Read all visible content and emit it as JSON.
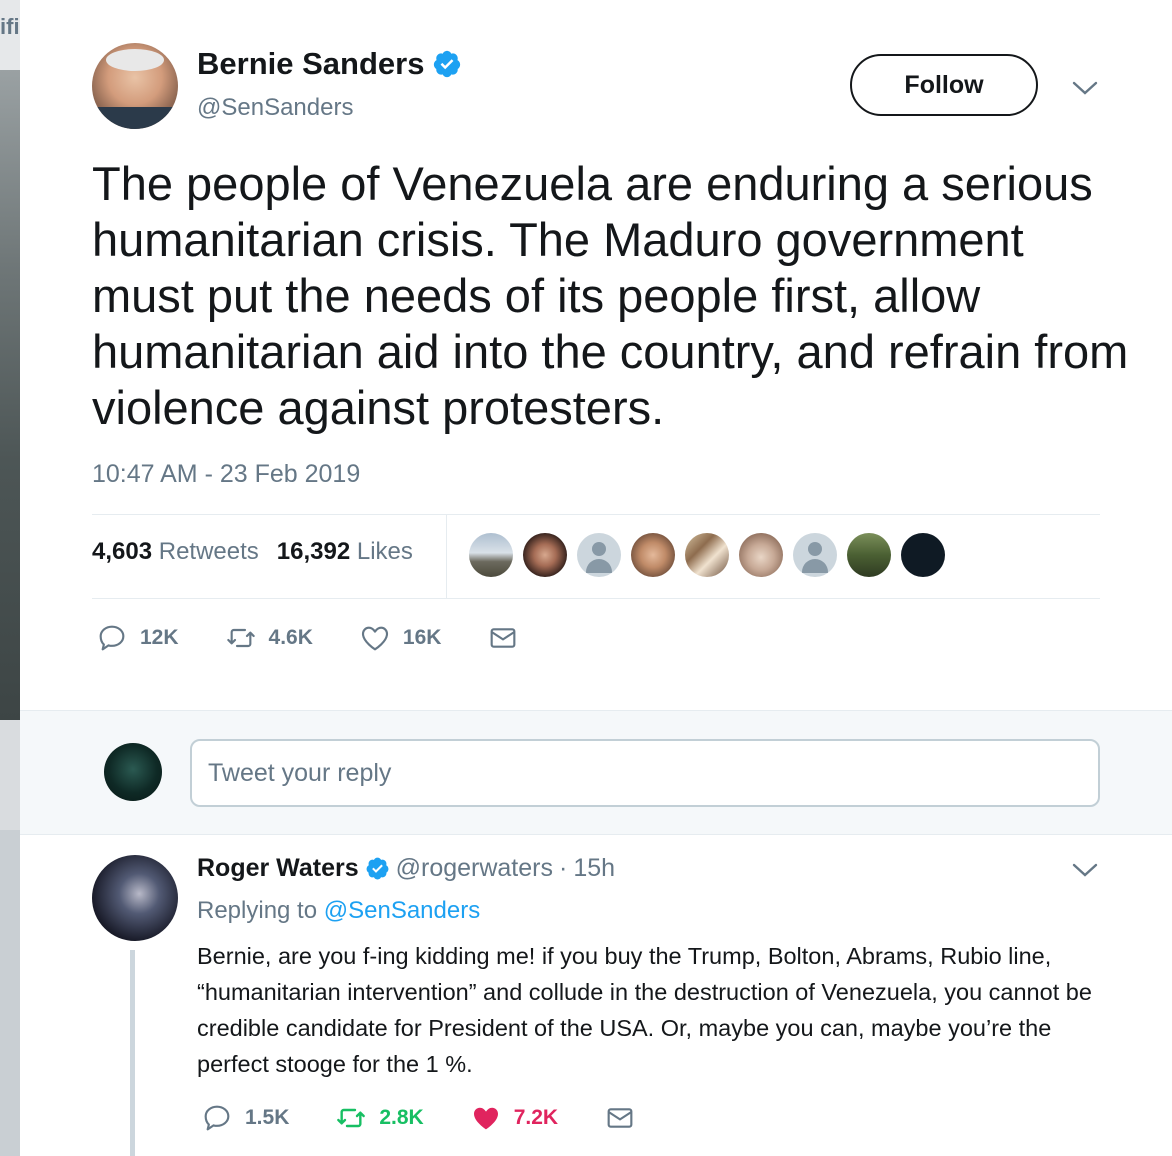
{
  "backdrop": {
    "partial_text": "ifi"
  },
  "tweet": {
    "author": {
      "name": "Bernie Sanders",
      "handle": "@SenSanders",
      "verified": true
    },
    "follow_label": "Follow",
    "text": "The people of Venezuela are enduring a serious humanitarian crisis. The Maduro government must put the needs of its people first, allow humanitarian aid into the country, and refrain from violence against protesters.",
    "timestamp": "10:47 AM - 23 Feb 2019",
    "stats": {
      "retweets_count": "4,603",
      "retweets_label": "Retweets",
      "likes_count": "16,392",
      "likes_label": "Likes"
    },
    "actions": {
      "reply_count": "12K",
      "retweet_count": "4.6K",
      "like_count": "16K"
    }
  },
  "reply_box": {
    "placeholder": "Tweet your reply"
  },
  "reply": {
    "author_name": "Roger Waters",
    "author_handle": "@rogerwaters",
    "verified": true,
    "separator": "·",
    "time": "15h",
    "replying_prefix": "Replying to",
    "replying_to": "@SenSanders",
    "text": "Bernie, are you f-ing kidding me! if you buy the Trump, Bolton, Abrams, Rubio line, “humanitarian intervention” and collude in the destruction of Venezuela, you cannot be credible candidate for President of the USA. Or, maybe you can, maybe you’re the perfect stooge for the 1 %.",
    "actions": {
      "reply_count": "1.5K",
      "retweet_count": "2.8K",
      "like_count": "7.2K"
    }
  },
  "colors": {
    "text_primary": "#14171a",
    "text_secondary": "#657786",
    "link_blue": "#1da1f2",
    "verified_blue": "#1da1f2",
    "retweet_green": "#17bf63",
    "like_red": "#e0245e"
  },
  "icons": {
    "verified": "verified-badge-icon",
    "caret": "chevron-down-icon",
    "reply": "reply-icon",
    "retweet": "retweet-icon",
    "like": "heart-icon",
    "dm": "envelope-icon"
  }
}
